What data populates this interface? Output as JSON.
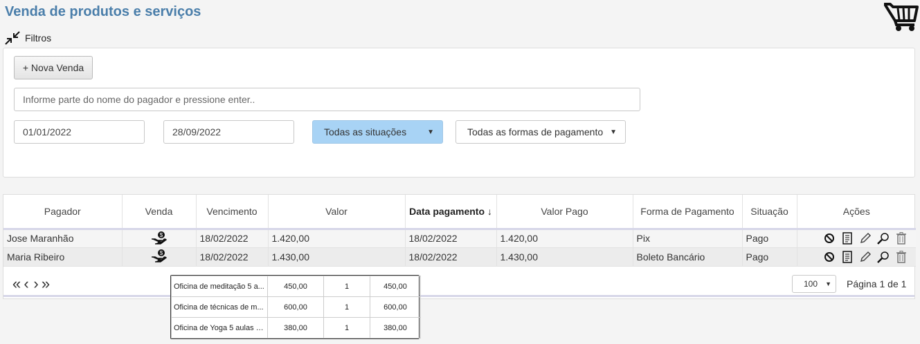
{
  "header": {
    "title": "Venda de produtos e serviços"
  },
  "filters": {
    "toggle_label": "Filtros",
    "new_sale_label": "+ Nova Venda",
    "search_placeholder": "Informe parte do nome do pagador e pressione enter..",
    "date_from": "01/01/2022",
    "date_to": "28/09/2022",
    "status_selected": "Todas as situações",
    "payment_selected": "Todas as formas de pagamento"
  },
  "table": {
    "columns": [
      "Pagador",
      "Venda",
      "Vencimento",
      "Valor",
      "Data pagamento ↓",
      "Valor Pago",
      "Forma de Pagamento",
      "Situação",
      "Ações"
    ],
    "rows": [
      {
        "payer": "Jose Maranhão",
        "due": "18/02/2022",
        "value": "1.420,00",
        "paid_date": "18/02/2022",
        "paid_value": "1.420,00",
        "method": "Pix",
        "status": "Pago"
      },
      {
        "payer": "Maria Ribeiro",
        "due": "18/02/2022",
        "value": "1.430,00",
        "paid_date": "18/02/2022",
        "paid_value": "1.430,00",
        "method": "Boleto Bancário",
        "status": "Pago"
      }
    ]
  },
  "pager": {
    "page_size": "100",
    "page_info": "Página 1 de 1"
  },
  "popup": {
    "items": [
      {
        "name": "Oficina de meditação 5 a...",
        "price": "450,00",
        "qty": "1",
        "total": "450,00"
      },
      {
        "name": "Oficina de técnicas de m...",
        "price": "600,00",
        "qty": "1",
        "total": "600,00"
      },
      {
        "name": "Oficina de Yoga 5 aulas d...",
        "price": "380,00",
        "qty": "1",
        "total": "380,00"
      }
    ]
  },
  "colors": {
    "title": "#4a7eaa",
    "status_select_bg": "#a8d3f5"
  }
}
